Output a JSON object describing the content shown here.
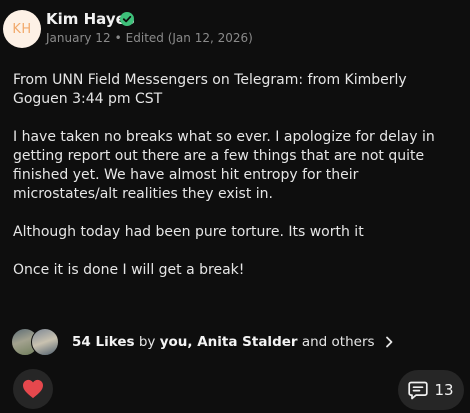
{
  "post": {
    "author": {
      "initials": "KH",
      "name": "Kim Hayes"
    },
    "date": "January 12",
    "separator": "•",
    "edited": "Edited (Jan 12, 2026)",
    "paragraphs": [
      "From UNN Field Messengers on Telegram:  from Kimberly  Goguen 3:44 pm CST",
      "I have taken no breaks what so ever. I apologize for delay in getting report out there are a few things that are not quite finished yet. We have almost hit entropy for their microstates/alt realities they exist in.",
      "Although today had been pure torture. Its worth it",
      "Once it is done I will get a break!"
    ]
  },
  "likes": {
    "count_label": "54 Likes",
    "by": "by",
    "names": "you, Anita Stalder",
    "others": "and others"
  },
  "actions": {
    "comment_count": "13"
  },
  "colors": {
    "background": "#0e0e0e",
    "verified": "#3ec07a",
    "heart": "#e5484d",
    "avatar_bg": "#fdf1e6",
    "avatar_fg": "#f2a96b"
  },
  "icons": {
    "verified": "verified-check-icon",
    "chevron": "chevron-right-icon",
    "heart": "heart-icon",
    "comment": "comment-icon"
  }
}
